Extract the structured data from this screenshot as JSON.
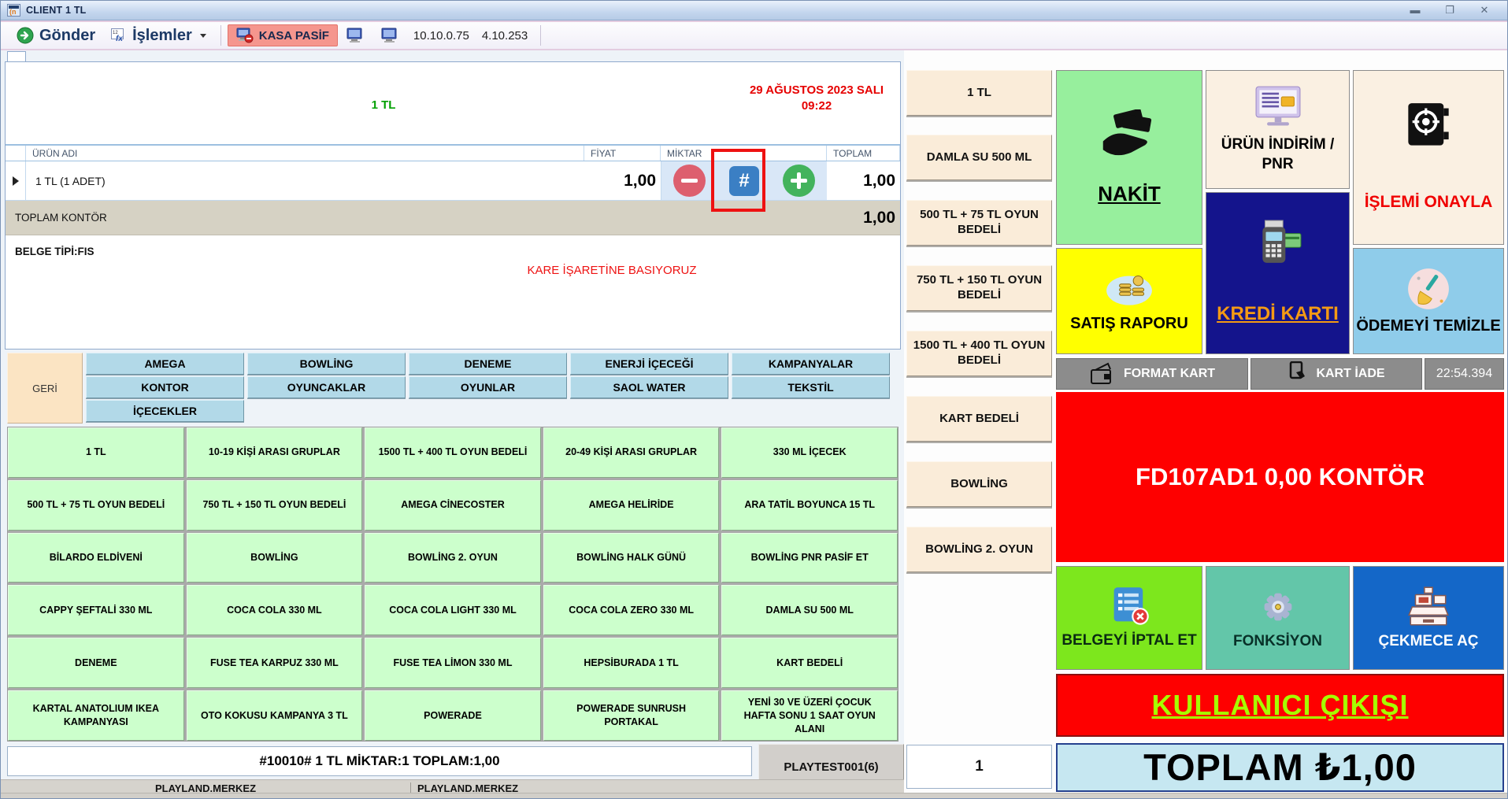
{
  "window": {
    "title": "CLIENT 1 TL"
  },
  "toolbar": {
    "gonder_label": "Gönder",
    "islemler_label": "İşlemler",
    "kasa_pasif_label": "KASA PASİF",
    "ip_primary": "10.10.0.75",
    "ip_secondary": "4.10.253"
  },
  "sale": {
    "product_label": "1 TL",
    "date_line": "29 AĞUSTOS 2023 SALI",
    "time_line": "09:22",
    "table": {
      "headers": {
        "urun_adi": "ÜRÜN ADI",
        "fiyat": "FİYAT",
        "miktar": "MİKTAR",
        "toplam": "TOPLAM"
      },
      "row": {
        "name": "1 TL (1 ADET)",
        "price": "1,00",
        "total": "1,00",
        "hash_label": "#"
      }
    },
    "total_kontor_label": "TOPLAM KONTÖR",
    "total_kontor_value": "1,00",
    "belge_tipi": "BELGE TİPİ:FIS",
    "annotation_note": "KARE İŞARETİNE BASIYORUZ"
  },
  "categories": {
    "back_label": "GERİ",
    "row1": [
      "AMEGA",
      "BOWLİNG",
      "DENEME",
      "ENERJİ İÇECEĞİ",
      "KAMPANYALAR"
    ],
    "row2": [
      "KONTOR",
      "OYUNCAKLAR",
      "OYUNLAR",
      "SAOL WATER",
      "TEKSTİL"
    ],
    "row3": [
      "İÇECEKLER"
    ]
  },
  "products": [
    "1 TL",
    "10-19 KİŞİ ARASI GRUPLAR",
    "1500 TL + 400 TL OYUN BEDELİ",
    "20-49 KİŞİ ARASI GRUPLAR",
    "330 ML İÇECEK",
    "500 TL + 75 TL OYUN BEDELİ",
    "750 TL + 150 TL OYUN BEDELİ",
    "AMEGA CİNECOSTER",
    "AMEGA HELİRİDE",
    "ARA TATİL BOYUNCA 15 TL",
    "BİLARDO ELDİVENİ",
    "BOWLİNG",
    "BOWLİNG 2. OYUN",
    "BOWLİNG HALK GÜNÜ",
    "BOWLİNG PNR PASİF ET",
    "CAPPY ŞEFTALİ 330 ML",
    "COCA COLA 330 ML",
    "COCA COLA LIGHT 330 ML",
    "COCA COLA ZERO 330 ML",
    "DAMLA SU 500 ML",
    "DENEME",
    "FUSE TEA KARPUZ 330 ML",
    "FUSE TEA LİMON 330 ML",
    "HEPSİBURADA 1 TL",
    "KART BEDELİ",
    "KARTAL ANATOLIUM IKEA KAMPANYASI",
    "OTO KOKUSU KAMPANYA 3 TL",
    "POWERADE",
    "POWERADE SUNRUSH PORTAKAL",
    "YENİ 30 VE ÜZERİ ÇOCUK HAFTA SONU 1 SAAT OYUN ALANI"
  ],
  "quick_items": [
    "1 TL",
    "DAMLA SU 500 ML",
    "500 TL + 75 TL OYUN BEDELİ",
    "750 TL + 150 TL OYUN BEDELİ",
    "1500 TL + 400 TL OYUN BEDELİ",
    "KART BEDELİ",
    "BOWLİNG",
    "BOWLİNG 2. OYUN"
  ],
  "quantity_value": "1",
  "bottom": {
    "summary": "#10010# 1 TL MİKTAR:1 TOPLAM:1,00",
    "user": "PLAYTEST001(6)",
    "status_left": "PLAYLAND.MERKEZ",
    "status_right": "PLAYLAND.MERKEZ"
  },
  "right_panel": {
    "nakit": "NAKİT",
    "urun_indirim": "ÜRÜN İNDİRİM / PNR",
    "islemi_onayla": "İŞLEMİ ONAYLA",
    "kredi_karti": "KREDİ KARTI",
    "satis_raporu": "SATIŞ RAPORU",
    "odemeyi_temizle": "ÖDEMEYİ TEMİZLE",
    "format_kart": "FORMAT KART",
    "kart_iade": "KART İADE",
    "timestamp": "22:54.394",
    "kontor_display": "FD107AD1 0,00 KONTÖR",
    "belgeyi_iptal": "BELGEYİ İPTAL ET",
    "fonksiyon": "FONKSİYON",
    "cekmece_ac": "ÇEKMECE AÇ",
    "kullanici_cikisi": "KULLANICI ÇIKIŞI",
    "toplam": "TOPLAM ₺1,00"
  },
  "colors": {
    "accent_green": "#97ef9d",
    "accent_navy": "#14148c",
    "accent_yellow": "#ffff00",
    "accent_red": "#fe0000",
    "product_green": "#ccffcc",
    "tab_blue": "#b2d9e8",
    "quick_cream": "#faecd9",
    "highlight_annotation": "#ee1111"
  }
}
